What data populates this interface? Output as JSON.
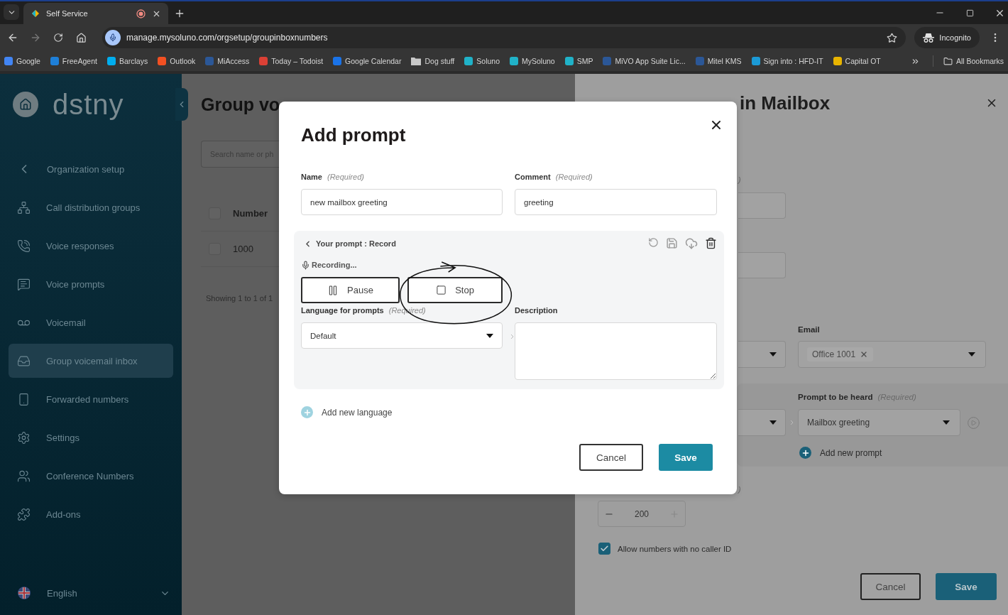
{
  "browser": {
    "tabs": [
      {
        "title": "Self Service",
        "selected": true
      }
    ],
    "url": "manage.mysoluno.com/orgsetup/groupinboxnumbers",
    "profile": "Incognito",
    "bookmarks": [
      {
        "label": "Google",
        "kind": "site",
        "color": "#4285f4"
      },
      {
        "label": "FreeAgent",
        "kind": "site",
        "color": "#1e7fd8"
      },
      {
        "label": "Barclays",
        "kind": "site",
        "color": "#00aeef"
      },
      {
        "label": "Outlook",
        "kind": "site",
        "color": "#f25022"
      },
      {
        "label": "MiAccess",
        "kind": "site",
        "color": "#2b5797"
      },
      {
        "label": "Today – Todoist",
        "kind": "site",
        "color": "#db4035"
      },
      {
        "label": "Google Calendar",
        "kind": "site",
        "color": "#1a73e8"
      },
      {
        "label": "Dog stuff",
        "kind": "folder",
        "color": "#c8c8c8"
      },
      {
        "label": "Soluno",
        "kind": "site",
        "color": "#20b2c8"
      },
      {
        "label": "MySoluno",
        "kind": "site",
        "color": "#20b2c8"
      },
      {
        "label": "SMP",
        "kind": "site",
        "color": "#20b2c8"
      },
      {
        "label": "MiVO App Suite Lic...",
        "kind": "site",
        "color": "#2b5797"
      },
      {
        "label": "Mitel KMS",
        "kind": "site",
        "color": "#2b5797"
      },
      {
        "label": "Sign into : HFD-IT",
        "kind": "site",
        "color": "#1b9ad6"
      },
      {
        "label": "Capital OT",
        "kind": "site",
        "color": "#e8b400"
      }
    ],
    "all_bookmarks": "All Bookmarks"
  },
  "sidebar": {
    "brand": "dstny",
    "back_item": "Organization setup",
    "items": [
      {
        "label": "Call distribution groups",
        "selected": false
      },
      {
        "label": "Voice responses",
        "selected": false
      },
      {
        "label": "Voice prompts",
        "selected": false
      },
      {
        "label": "Voicemail",
        "selected": false
      },
      {
        "label": "Group voicemail inbox",
        "selected": true
      },
      {
        "label": "Forwarded numbers",
        "selected": false
      },
      {
        "label": "Settings",
        "selected": false
      },
      {
        "label": "Conference Numbers",
        "selected": false
      },
      {
        "label": "Add-ons",
        "selected": false
      }
    ],
    "language": "English"
  },
  "page": {
    "title": "Group vo",
    "search": {
      "placeholder": "Search name or ph"
    },
    "table": {
      "columns": [
        "Number"
      ],
      "select_all_checked": false,
      "rows": [
        {
          "cells": [
            "1000"
          ],
          "checked": false
        }
      ]
    },
    "footer": "Showing 1 to 1 of 1"
  },
  "edit_panel": {
    "title": "in Mailbox",
    "label_fragments": [
      ")",
      ")"
    ],
    "email": {
      "label": "Email",
      "chips": [
        "Office 1001"
      ]
    },
    "prompt": {
      "label": "Prompt to be heard",
      "hint": "(Required)",
      "value": "Mailbox greeting",
      "add": "Add new prompt"
    },
    "stepper": {
      "value": "200"
    },
    "caller_id": {
      "label": "Allow numbers with no caller ID",
      "checked": true
    },
    "buttons": [
      {
        "label": "Cancel",
        "kind": "secondary"
      },
      {
        "label": "Save",
        "kind": "primary"
      }
    ]
  },
  "modal": {
    "title": "Add prompt",
    "fields": [
      {
        "label": "Name",
        "hint": "(Required)",
        "value": "new mailbox greeting"
      },
      {
        "label": "Comment",
        "hint": "(Required)",
        "value": "greeting"
      }
    ],
    "prompt_section": {
      "heading": "Your prompt : Record",
      "status": "Recording...",
      "controls": [
        {
          "label": "Pause",
          "kind": "pause"
        },
        {
          "label": "Stop",
          "kind": "stop"
        }
      ],
      "language": {
        "label": "Language for prompts",
        "hint": "(Required)",
        "value": "Default"
      },
      "description": {
        "label": "Description"
      }
    },
    "add_language": "Add new language",
    "buttons": [
      {
        "label": "Cancel",
        "kind": "secondary"
      },
      {
        "label": "Save",
        "kind": "primary"
      }
    ]
  }
}
